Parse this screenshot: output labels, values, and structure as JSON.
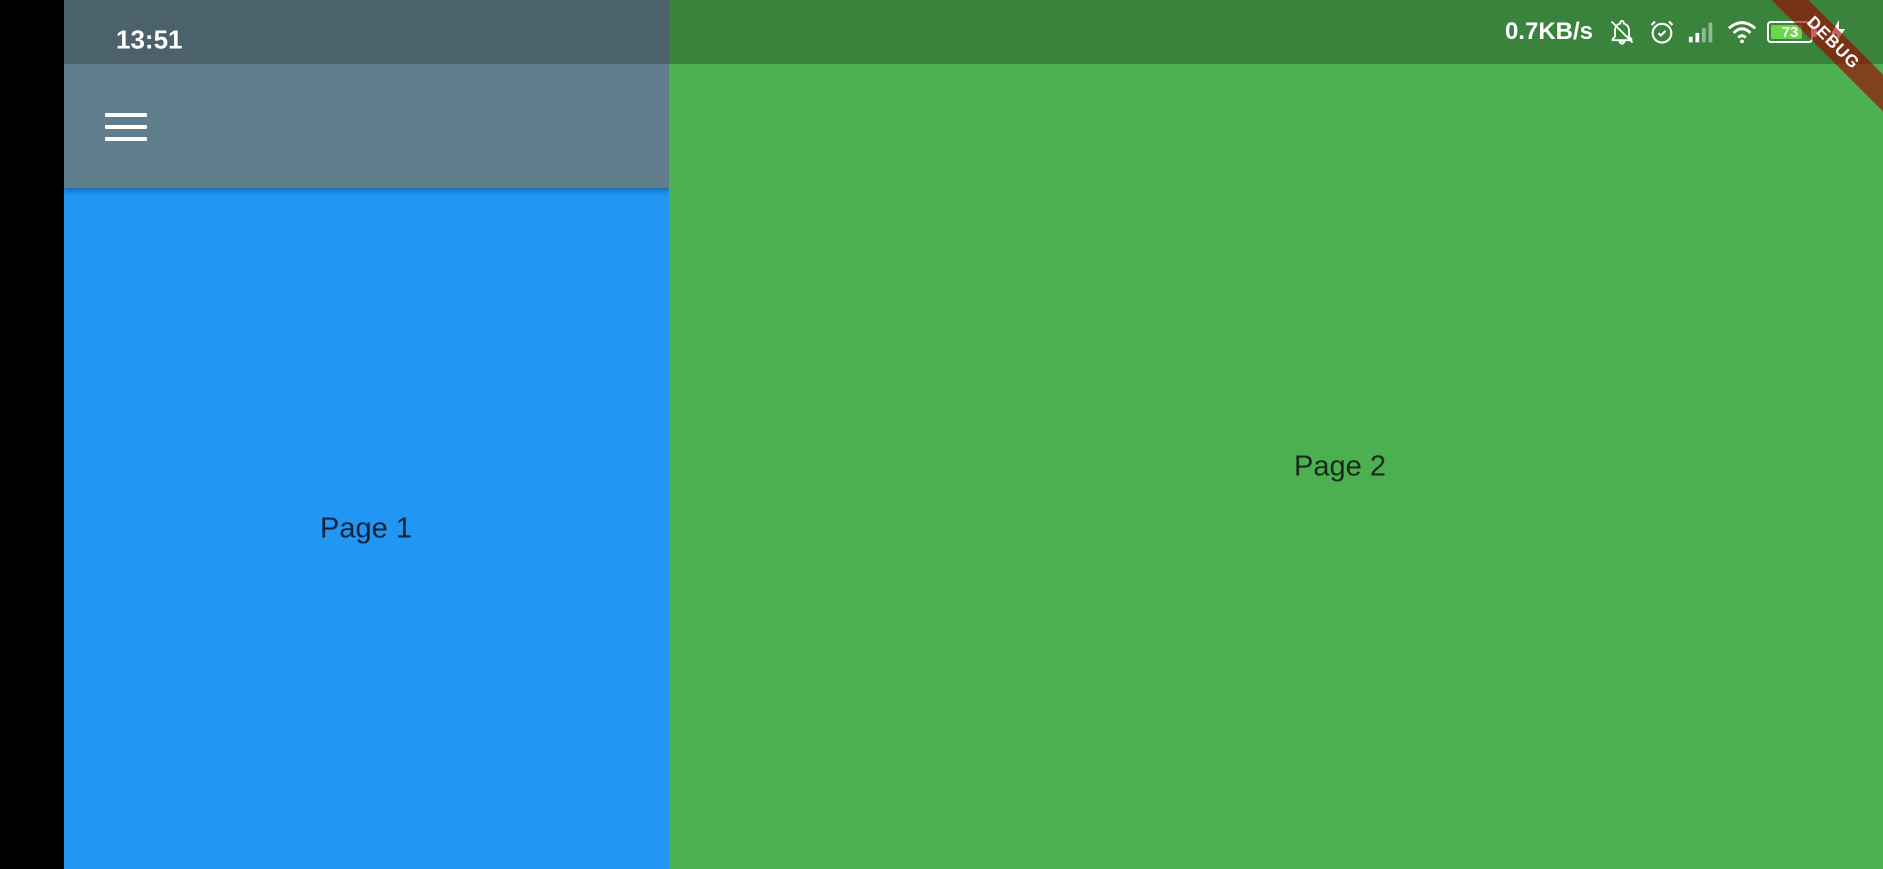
{
  "status_bar": {
    "time": "13:51",
    "net_speed": "0.7KB/s",
    "icons": [
      "notifications-off-icon",
      "alarm-icon",
      "signal-icon",
      "wifi-icon",
      "battery-icon",
      "charging-icon"
    ],
    "battery_level": "73"
  },
  "app_bar": {
    "menu_icon": "menu-icon"
  },
  "pages": {
    "page1": {
      "label": "Page 1",
      "color": "#2196f3"
    },
    "page2": {
      "label": "Page 2",
      "color": "#4caf50"
    }
  },
  "app_bar_color": "#607d8b",
  "debug_banner": {
    "label": "DEBUG"
  }
}
